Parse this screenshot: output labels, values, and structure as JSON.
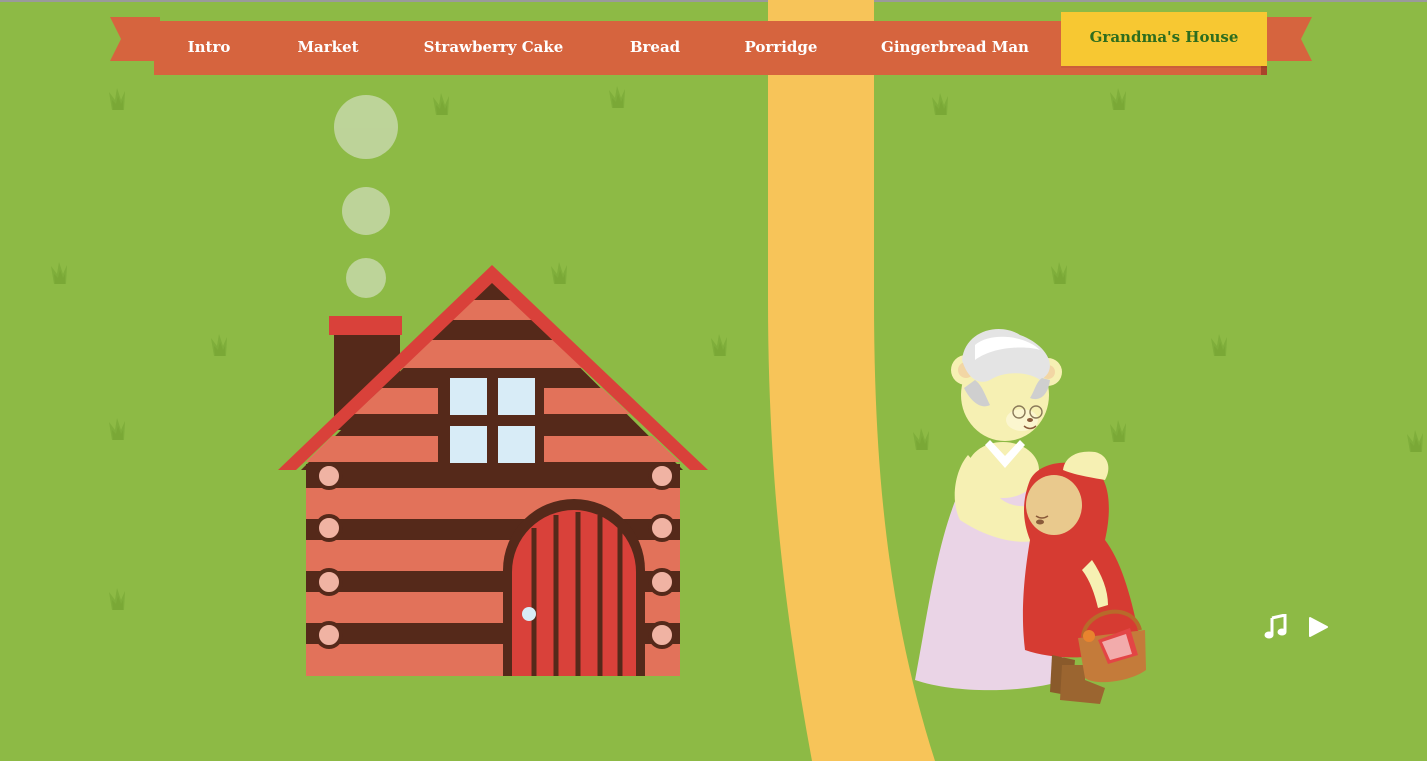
{
  "nav": {
    "items": [
      {
        "label": "Intro"
      },
      {
        "label": "Market"
      },
      {
        "label": "Strawberry Cake"
      },
      {
        "label": "Bread"
      },
      {
        "label": "Porridge"
      },
      {
        "label": "Gingerbread Man"
      },
      {
        "label": "Grandma's House"
      }
    ],
    "active_index": 6
  },
  "colors": {
    "grass": "#8dba45",
    "ribbon": "#d6643e",
    "active_tab": "#f7c832",
    "active_text": "#2e6d1e",
    "path": "#f7c459",
    "roof": "#d9413a",
    "logs": "#e2725a",
    "dark_logs": "#55291a"
  },
  "icons": {
    "music": "music-note-icon",
    "play": "play-icon"
  }
}
